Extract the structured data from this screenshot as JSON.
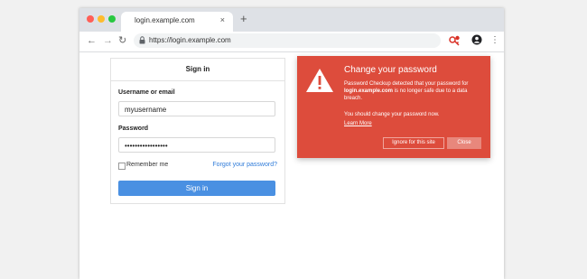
{
  "browser": {
    "tab_title": "login.example.com",
    "tab_close": "×",
    "new_tab": "+",
    "url": "https://login.example.com",
    "nav": {
      "back": "←",
      "forward": "→",
      "reload": "↻"
    },
    "menu": "⋮"
  },
  "signin": {
    "title": "Sign in",
    "username_label": "Username or email",
    "username_value": "myusername",
    "password_label": "Password",
    "password_value": "•••••••••••••••••",
    "remember_label": "Remember me",
    "forgot_link": "Forgot your password?",
    "button": "Sign in"
  },
  "alert": {
    "title": "Change your password",
    "text_before": "Password Checkup detected that your password for ",
    "domain": "login.example.com",
    "text_after": " is no longer safe due to a data breach.",
    "advice": "You should change your password now.",
    "learn_more": "Learn More",
    "ignore_button": "Ignore for this site",
    "close_button": "Close"
  },
  "colors": {
    "alert_red": "#dd4c3c",
    "signin_blue": "#4a90e2",
    "link_blue": "#2f7bd9"
  }
}
